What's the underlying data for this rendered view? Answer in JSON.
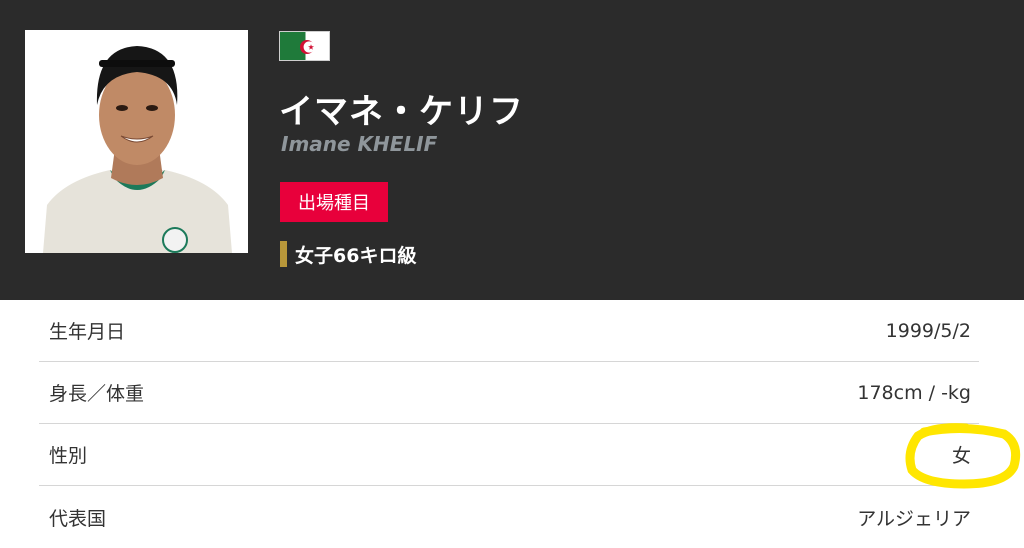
{
  "athlete": {
    "name_jp": "イマネ・ケリフ",
    "name_en": "Imane KHELIF",
    "country_flag_icon": "algeria-flag-icon"
  },
  "events": {
    "badge_label": "出場種目",
    "items": [
      "女子66キロ級"
    ]
  },
  "info": {
    "rows": [
      {
        "label": "生年月日",
        "value": "1999/5/2"
      },
      {
        "label": "身長／体重",
        "value": "178cm / -kg"
      },
      {
        "label": "性別",
        "value": "女"
      },
      {
        "label": "代表国",
        "value": "アルジェリア"
      }
    ]
  },
  "colors": {
    "header_bg": "#2b2b2b",
    "badge_red": "#e8003b",
    "event_bar_gold": "#b8973a",
    "highlight_yellow": "#ffe600"
  }
}
